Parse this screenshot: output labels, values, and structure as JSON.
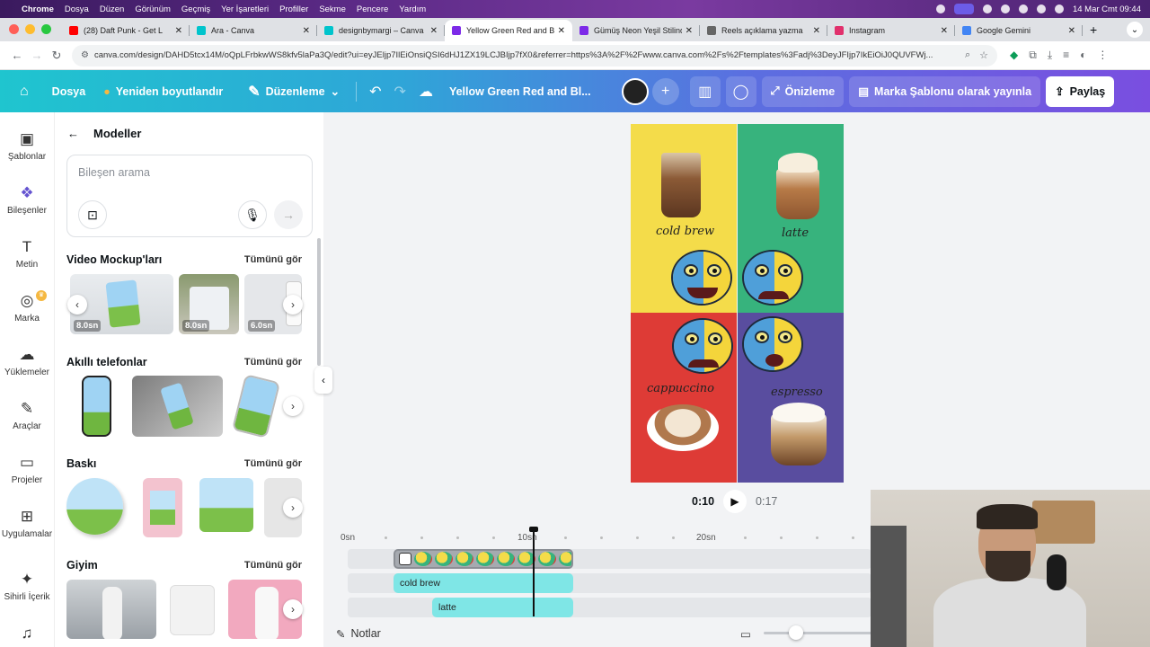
{
  "menubar": {
    "app": "Chrome",
    "items": [
      "Dosya",
      "Düzen",
      "Görünüm",
      "Geçmiş",
      "Yer İşaretleri",
      "Profiller",
      "Sekme",
      "Pencere",
      "Yardım"
    ],
    "clock": "14 Mar Cmt  09:44"
  },
  "tabs": [
    {
      "title": "(28) Daft Punk - Get L",
      "color": "#ff0000"
    },
    {
      "title": "Ara - Canva",
      "color": "#00c4cc"
    },
    {
      "title": "designbymargi – Canva",
      "color": "#00c4cc"
    },
    {
      "title": "Yellow Green Red and Blu",
      "color": "#7d2ae8",
      "active": true
    },
    {
      "title": "Gümüş Neon Yeşil Stilind",
      "color": "#7d2ae8"
    },
    {
      "title": "Reels açıklama yazma",
      "color": "#666666"
    },
    {
      "title": "Instagram",
      "color": "#e1306c"
    },
    {
      "title": "Google Gemini",
      "color": "#4285f4"
    }
  ],
  "url": "canva.com/design/DAHD5tcx14M/oQpLFrbkwWS8kfv5laPa3Q/edit?ui=eyJEljp7IlEiOnsiQSI6dHJ1ZX19LCJBIjp7fX0&referrer=https%3A%2F%2Fwww.canva.com%2Fs%2Ftemplates%3Fadj%3DeyJFIjp7IkEiOiJ0QUVFWj...",
  "header": {
    "home": "Dosya",
    "resize": "Yeniden boyutlandır",
    "edit": "Düzenleme",
    "doc_title": "Yellow Green Red and Bl...",
    "preview": "Önizleme",
    "brand_template": "Marka Şablonu olarak yayınla",
    "share": "Paylaş"
  },
  "rail": [
    {
      "label": "Şablonlar",
      "icon": "template-icon",
      "glyph": "▣"
    },
    {
      "label": "Bileşenler",
      "icon": "elements-icon",
      "glyph": "❖",
      "active": true
    },
    {
      "label": "Metin",
      "icon": "text-icon",
      "glyph": "T"
    },
    {
      "label": "Marka",
      "icon": "brand-icon",
      "glyph": "◎",
      "crown": true
    },
    {
      "label": "Yüklemeler",
      "icon": "upload-cloud-icon",
      "glyph": "☁"
    },
    {
      "label": "Araçlar",
      "icon": "pen-icon",
      "glyph": "✎"
    },
    {
      "label": "Projeler",
      "icon": "folder-icon",
      "glyph": "▭"
    },
    {
      "label": "Uygulamalar",
      "icon": "apps-icon",
      "glyph": "⊞"
    },
    {
      "label": "Sihirli İçerik",
      "icon": "magic-icon",
      "glyph": "✦"
    },
    {
      "label": "",
      "icon": "music-icon",
      "glyph": "♫"
    }
  ],
  "panel": {
    "title": "Modeller",
    "search_placeholder": "Bileşen arama",
    "sections": [
      {
        "title": "Video Mockup'ları",
        "link": "Tümünü gör",
        "durations": [
          "8.0sn",
          "8.0sn",
          "6.0sn"
        ]
      },
      {
        "title": "Akıllı telefonlar",
        "link": "Tümünü gör"
      },
      {
        "title": "Baskı",
        "link": "Tümünü gör"
      },
      {
        "title": "Giyim",
        "link": "Tümünü gör"
      }
    ]
  },
  "design": {
    "labels": [
      "cold brew",
      "latte",
      "cappuccino",
      "espresso"
    ],
    "colors": {
      "yellow": "#f4dc4a",
      "green": "#37b37d",
      "red": "#de3b36",
      "purple": "#594d9f"
    }
  },
  "playback": {
    "current": "0:10",
    "total": "0:17"
  },
  "timeline": {
    "ticks": [
      "0sn",
      "10sn",
      "20sn"
    ],
    "clips": [
      "cold brew",
      "latte"
    ]
  },
  "notes": "Notlar"
}
